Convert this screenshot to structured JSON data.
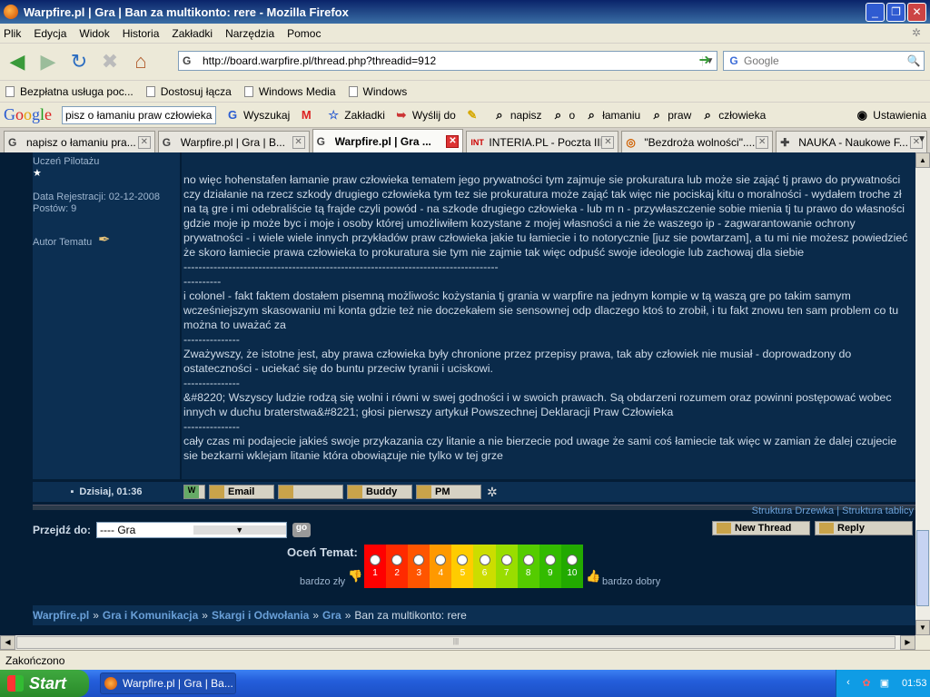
{
  "window": {
    "title": "Warpfire.pl | Gra | Ban za multikonto: rere - Mozilla Firefox"
  },
  "menubar": [
    "Plik",
    "Edycja",
    "Widok",
    "Historia",
    "Zakładki",
    "Narzędzia",
    "Pomoc"
  ],
  "navbar": {
    "url": "http://board.warpfire.pl/thread.php?threadid=912",
    "search_placeholder": "Google"
  },
  "bookmarks": [
    "Bezpłatna usługa poc...",
    "Dostosuj łącza",
    "Windows Media",
    "Windows"
  ],
  "google_toolbar": {
    "query": "pisz o łamaniu praw człowieka",
    "search_label": "Wyszukaj",
    "bookmarks_label": "Zakładki",
    "send_label": "Wyślij do",
    "terms": [
      "napisz",
      "o",
      "łamaniu",
      "praw",
      "człowieka"
    ],
    "settings_label": "Ustawienia"
  },
  "tabs": [
    {
      "label": "napisz o łamaniu pra...",
      "active": false
    },
    {
      "label": "Warpfire.pl | Gra | B...",
      "active": false
    },
    {
      "label": "Warpfire.pl | Gra ...",
      "active": true
    },
    {
      "label": "INTERIA.PL - Poczta III",
      "active": false
    },
    {
      "label": "\"Bezdroża wolności\"....",
      "active": false
    },
    {
      "label": "NAUKA - Naukowe F...",
      "active": false
    }
  ],
  "post": {
    "user_rank": "Uczeń Pilotażu",
    "registration": "Data Rejestracji: 02-12-2008",
    "posts": "Postów: 9",
    "author_label": "Autor Tematu",
    "paragraphs": [
      "no więc hohenstafen łamanie praw człowieka tematem jego prywatności tym zajmuje sie prokuratura lub może sie zająć tj prawo do prywatności czy działanie na rzecz szkody drugiego człowieka tym tez sie prokuratura może zająć tak więc nie pociskaj kitu o moralności - wydałem troche zł na tą gre i mi odebraliście tą frajde czyli powód - na szkode drugiego człowieka - lub m n - przywłaszczenie sobie mienia tj tu prawo do własności gdzie moje ip może byc i moje i osoby której umożliwiłem kozystane z mojej własności a nie że waszego ip - zagwarantowanie ochrony prywatności - i wiele wiele innych przykładów praw człowieka jakie tu łamiecie i to notorycznie [juz sie powtarzam], a tu mi nie możesz powiedzieć że skoro łamiecie prawa człowieka to prokuratura sie tym nie zajmie tak więc odpuść swoje ideologie lub zachowaj dla siebie",
      "------------------------------------------------------------------------------------",
      "----------",
      "i colonel - fakt faktem dostałem pisemną możliwośc kożystania tj grania w warpfire na jednym kompie w tą waszą gre po takim samym wcześniejszym skasowaniu mi konta gdzie też nie doczekałem sie sensownej odp dlaczego ktoś to zrobił, i tu fakt znowu ten sam problem co tu można to uważać za",
      "---------------",
      "Zważywszy, że istotne jest, aby prawa człowieka były chronione przez przepisy prawa, tak aby człowiek nie musiał - doprowadzony do ostateczności - uciekać się do buntu przeciw tyranii i uciskowi.",
      "---------------",
      "&#8220; Wszyscy ludzie rodzą się wolni i równi w swej godności i w swoich prawach. Są obdarzeni rozumem oraz powinni postępować wobec innych w duchu braterstwa&#8221; głosi pierwszy artykuł Powszechnej Deklaracji Praw Człowieka",
      "---------------",
      "cały czas mi podajecie jakieś swoje przykazania czy litanie a nie bierzecie pod uwage że sami coś łamiecie tak więc w zamian że dalej czujecie sie bezkarni wklejam litanie która obowiązuje nie tylko w tej grze"
    ],
    "date": "Dzisiaj, 01:36",
    "buttons": [
      "Email",
      "",
      "Buddy",
      "PM"
    ]
  },
  "structure": {
    "tree": "Struktura Drzewka",
    "table": "Struktura tablicy"
  },
  "jump": {
    "label": "Przejdź do:",
    "selected": "---- Gra"
  },
  "actions": {
    "new_thread": "New Thread",
    "reply": "Reply"
  },
  "rating": {
    "label": "Oceń Temat:",
    "low": "bardzo zły",
    "high": "bardzo dobry",
    "values": [
      "1",
      "2",
      "3",
      "4",
      "5",
      "6",
      "7",
      "8",
      "9",
      "10"
    ],
    "colors": [
      "#ff0000",
      "#ff2a00",
      "#ff5500",
      "#ff9900",
      "#ffcc00",
      "#ccdd00",
      "#99dd00",
      "#55cc00",
      "#33bb00",
      "#22aa00"
    ]
  },
  "breadcrumb": {
    "items": [
      "Warpfire.pl",
      "Gra i Komunikacja",
      "Skargi i Odwołania",
      "Gra"
    ],
    "sep": "»",
    "current": "Ban za multikonto: rere"
  },
  "statusbar": {
    "text": "Zakończono"
  },
  "taskbar": {
    "start": "Start",
    "item": "Warpfire.pl | Gra | Ba...",
    "clock": "01:53"
  }
}
